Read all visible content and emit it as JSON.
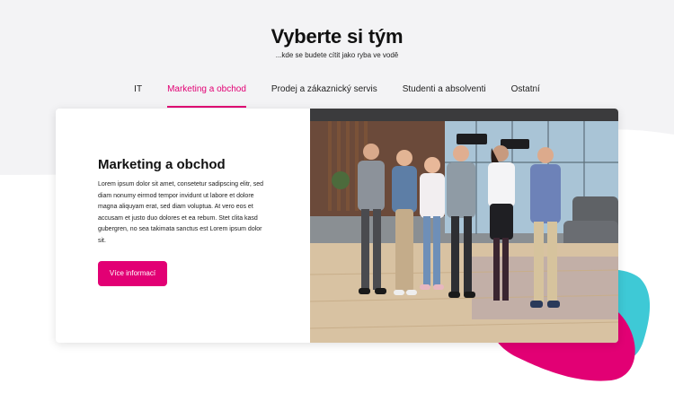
{
  "header": {
    "title": "Vyberte si tým",
    "subtitle": "...kde se budete cítit jako ryba ve vodě"
  },
  "tabs": [
    {
      "label": "IT",
      "active": false
    },
    {
      "label": "Marketing a obchod",
      "active": true
    },
    {
      "label": "Prodej a zákaznický servis",
      "active": false
    },
    {
      "label": "Studenti a absolventi",
      "active": false
    },
    {
      "label": "Ostatní",
      "active": false
    }
  ],
  "card": {
    "heading": "Marketing a obchod",
    "body": "Lorem ipsum dolor sit amet, consetetur sadipscing elitr, sed diam nonumy eirmod tempor invidunt ut labore et dolore magna aliquyam erat, sed diam voluptua. At vero eos et accusam et justo duo dolores et ea rebum. Stet clita kasd gubergren, no sea takimata sanctus est Lorem ipsum dolor sit.",
    "button_label": "Více informací"
  },
  "colors": {
    "accent": "#e20074",
    "decor_pink": "#e20074",
    "decor_teal": "#3ec9d6",
    "background_wave": "#f2f2f4"
  },
  "icons": {
    "photo": "team-photo"
  }
}
